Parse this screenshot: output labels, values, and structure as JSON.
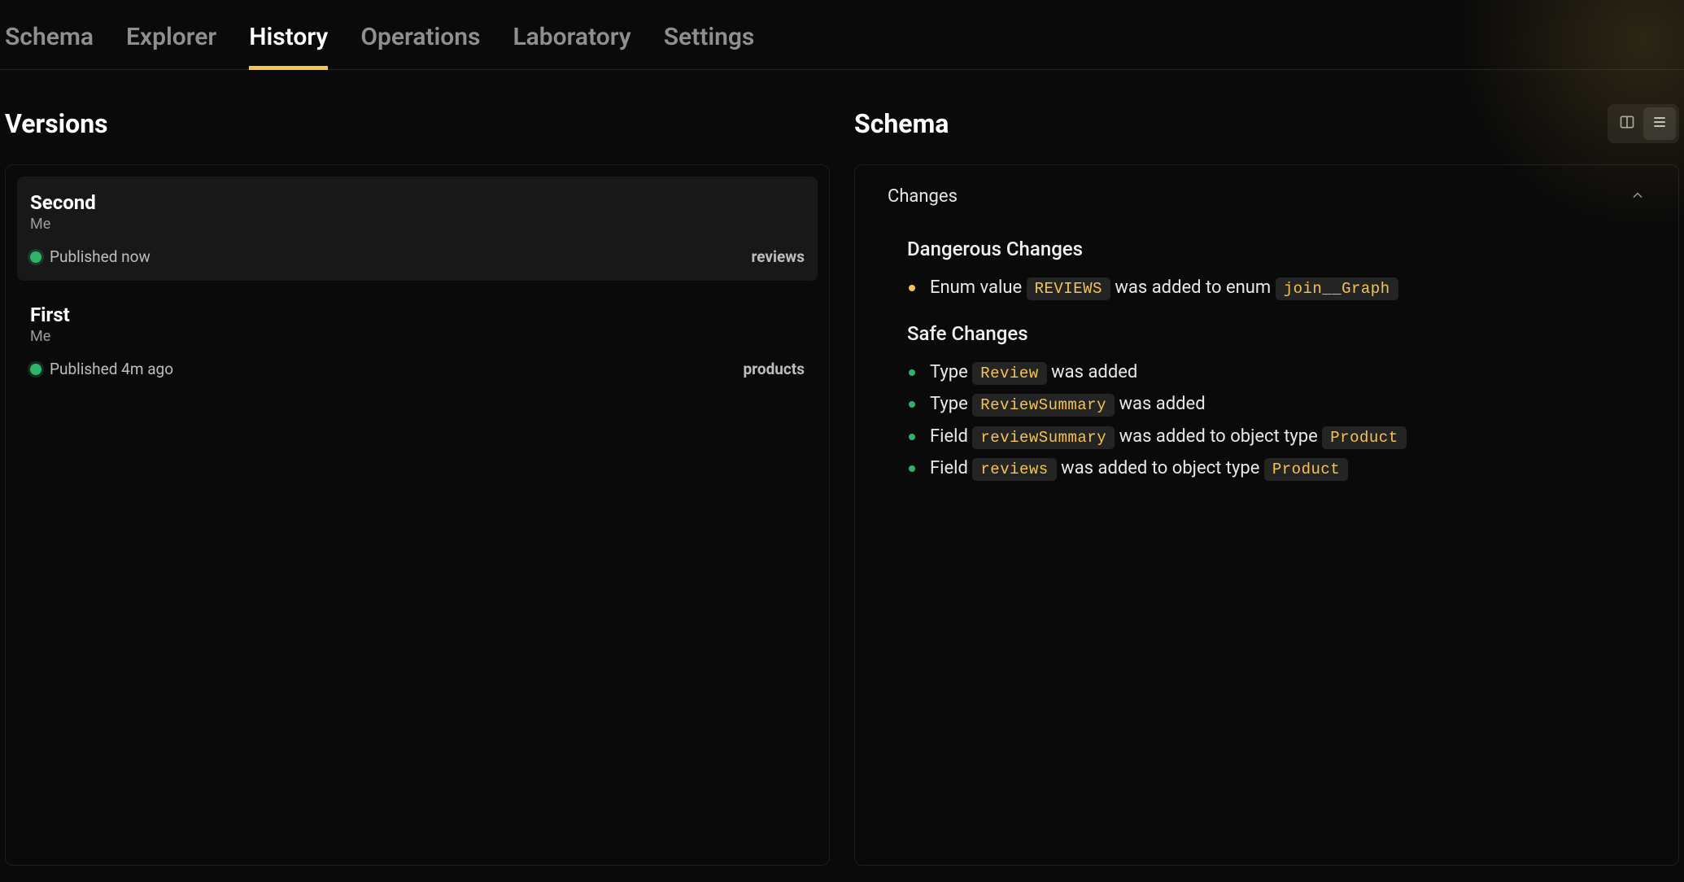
{
  "tabs": [
    {
      "label": "Schema",
      "active": false
    },
    {
      "label": "Explorer",
      "active": false
    },
    {
      "label": "History",
      "active": true
    },
    {
      "label": "Operations",
      "active": false
    },
    {
      "label": "Laboratory",
      "active": false
    },
    {
      "label": "Settings",
      "active": false
    }
  ],
  "versions": {
    "title": "Versions",
    "items": [
      {
        "name": "Second",
        "author": "Me",
        "status": "Published now",
        "tag": "reviews",
        "selected": true
      },
      {
        "name": "First",
        "author": "Me",
        "status": "Published 4m ago",
        "tag": "products",
        "selected": false
      }
    ]
  },
  "schema": {
    "title": "Schema",
    "changes_label": "Changes",
    "dangerous_title": "Dangerous Changes",
    "safe_title": "Safe Changes",
    "dangerous": [
      {
        "segments": [
          {
            "type": "text",
            "value": "Enum value "
          },
          {
            "type": "code",
            "value": "REVIEWS"
          },
          {
            "type": "text",
            "value": " was added to enum "
          },
          {
            "type": "code",
            "value": "join__Graph"
          }
        ]
      }
    ],
    "safe": [
      {
        "segments": [
          {
            "type": "text",
            "value": "Type "
          },
          {
            "type": "code",
            "value": "Review"
          },
          {
            "type": "text",
            "value": " was added"
          }
        ]
      },
      {
        "segments": [
          {
            "type": "text",
            "value": "Type "
          },
          {
            "type": "code",
            "value": "ReviewSummary"
          },
          {
            "type": "text",
            "value": " was added"
          }
        ]
      },
      {
        "segments": [
          {
            "type": "text",
            "value": "Field "
          },
          {
            "type": "code",
            "value": "reviewSummary"
          },
          {
            "type": "text",
            "value": " was added to object type "
          },
          {
            "type": "code",
            "value": "Product"
          }
        ]
      },
      {
        "segments": [
          {
            "type": "text",
            "value": "Field "
          },
          {
            "type": "code",
            "value": "reviews"
          },
          {
            "type": "text",
            "value": " was added to object type "
          },
          {
            "type": "code",
            "value": "Product"
          }
        ]
      }
    ]
  }
}
